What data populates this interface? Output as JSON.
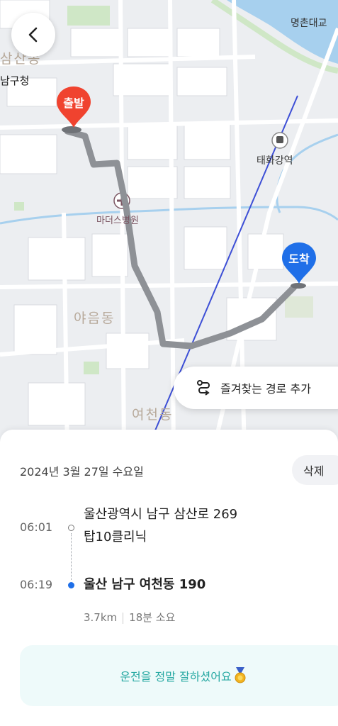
{
  "map": {
    "labels": {
      "myeongchon_bridge": "명촌대교",
      "samsan_dong": "삼산동",
      "namgu_office": "남구청",
      "taehwagang_station": "태화강역",
      "mothers_hospital": "마더스병원",
      "yaeum_dong": "야음동",
      "yeocheon_dong": "여천동"
    },
    "start_pin": "출발",
    "end_pin": "도착",
    "favorite_button": "즐겨찾는 경로 추가",
    "colors": {
      "route": "#8e9196",
      "rail": "#3d4fd6",
      "start_pin": "#f0432f",
      "end_pin": "#1f6fe8",
      "water": "#a7d0ee"
    }
  },
  "sheet": {
    "date": "2024년 3월 27일 수요일",
    "delete_label": "삭제",
    "start": {
      "time": "06:01",
      "address_line1": "울산광역시 남구 삼산로 269",
      "address_line2": "탑10클리닉"
    },
    "end": {
      "time": "06:19",
      "address": "울산 남구 여천동 190"
    },
    "distance": "3.7km",
    "duration": "18분 소요",
    "message": "운전을 정말 잘하셨어요",
    "message_icon": "medal-icon"
  }
}
